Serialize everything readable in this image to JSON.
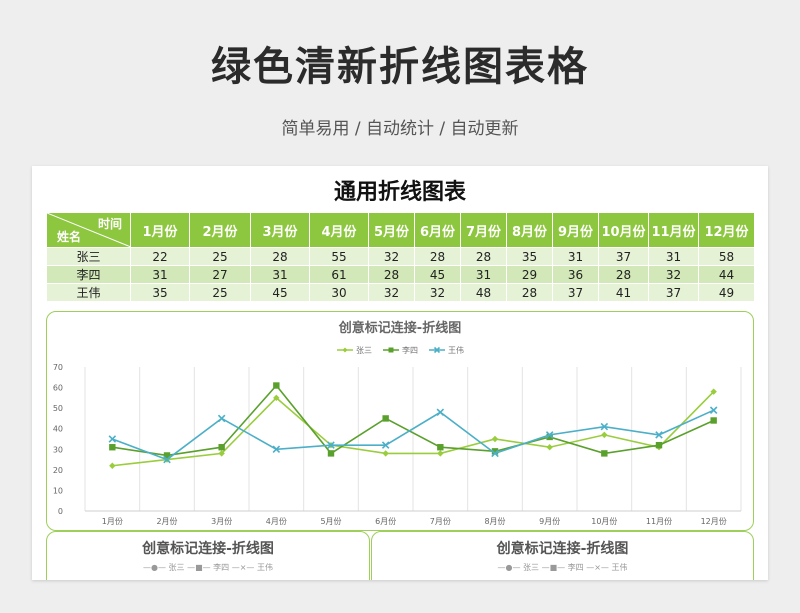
{
  "hero": {
    "title": "绿色清新折线图表格",
    "subtitle": "简单易用 / 自动统计 / 自动更新"
  },
  "sheet": {
    "title": "通用折线图表",
    "corner_top": "时间",
    "corner_bottom": "姓名",
    "months": [
      "1月份",
      "2月份",
      "3月份",
      "4月份",
      "5月份",
      "6月份",
      "7月份",
      "8月份",
      "9月份",
      "10月份",
      "11月份",
      "12月份"
    ],
    "rows": [
      {
        "name": "张三",
        "values": [
          22,
          25,
          28,
          55,
          32,
          28,
          28,
          35,
          31,
          37,
          31,
          58
        ]
      },
      {
        "name": "李四",
        "values": [
          31,
          27,
          31,
          61,
          28,
          45,
          31,
          29,
          36,
          28,
          32,
          44
        ]
      },
      {
        "name": "王伟",
        "values": [
          35,
          25,
          45,
          30,
          32,
          32,
          48,
          28,
          37,
          41,
          37,
          49
        ]
      }
    ]
  },
  "colors": {
    "accent": "#8dc63f",
    "series": [
      "#9acd3c",
      "#5aa02c",
      "#4bafc8"
    ]
  },
  "chart_data": {
    "type": "line",
    "title": "创意标记连接-折线图",
    "categories": [
      "1月份",
      "2月份",
      "3月份",
      "4月份",
      "5月份",
      "6月份",
      "7月份",
      "8月份",
      "9月份",
      "10月份",
      "11月份",
      "12月份"
    ],
    "series": [
      {
        "name": "张三",
        "marker": "diamond",
        "values": [
          22,
          25,
          28,
          55,
          32,
          28,
          28,
          35,
          31,
          37,
          31,
          58
        ]
      },
      {
        "name": "李四",
        "marker": "square",
        "values": [
          31,
          27,
          31,
          61,
          28,
          45,
          31,
          29,
          36,
          28,
          32,
          44
        ]
      },
      {
        "name": "王伟",
        "marker": "x",
        "values": [
          35,
          25,
          45,
          30,
          32,
          32,
          48,
          28,
          37,
          41,
          37,
          49
        ]
      }
    ],
    "ylim": [
      0,
      70
    ],
    "yticks": [
      0,
      10,
      20,
      30,
      40,
      50,
      60,
      70
    ],
    "grid": "vertical",
    "legend": "top"
  },
  "bottom_panels": [
    {
      "title": "创意标记连接-折线图",
      "legend": "—●— 张三  —■— 李四  —×— 王伟"
    },
    {
      "title": "创意标记连接-折线图",
      "legend": "—●— 张三  —■— 李四  —×— 王伟"
    }
  ]
}
